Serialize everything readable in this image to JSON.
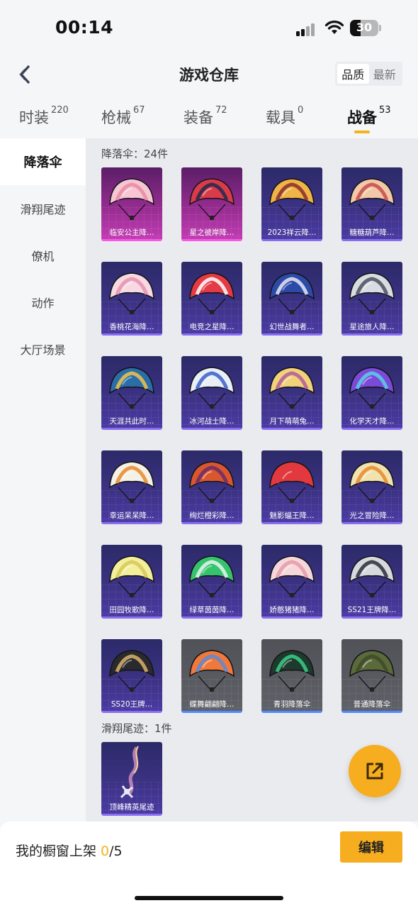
{
  "status_bar": {
    "time": "00:14",
    "battery": "30"
  },
  "header": {
    "title": "游戏仓库",
    "sort_options": [
      "品质",
      "最新"
    ]
  },
  "tabs": [
    {
      "label": "时装",
      "count": "220"
    },
    {
      "label": "枪械",
      "count": "67"
    },
    {
      "label": "装备",
      "count": "72"
    },
    {
      "label": "载具",
      "count": "0"
    },
    {
      "label": "战备",
      "count": "53"
    }
  ],
  "sidebar": {
    "items": [
      "降落伞",
      "滑翔尾迹",
      "僚机",
      "动作",
      "大厅场景"
    ]
  },
  "sections": {
    "parachutes": {
      "title": "降落伞：24件",
      "items": [
        {
          "name": "临安公主降…",
          "rarity": "pink",
          "icon": "pink-floral-canopy"
        },
        {
          "name": "星之彼岸降…",
          "rarity": "pink",
          "icon": "dark-star-canopy"
        },
        {
          "name": "2023祥云降…",
          "rarity": "purple",
          "icon": "golden-cloud-canopy"
        },
        {
          "name": "糖糖葫芦降…",
          "rarity": "purple",
          "icon": "candy-canopy"
        },
        {
          "name": "香桃花海降…",
          "rarity": "purple",
          "icon": "peach-blossom-canopy"
        },
        {
          "name": "电竞之星降…",
          "rarity": "purple",
          "icon": "red-esports-canopy"
        },
        {
          "name": "幻世战舞者…",
          "rarity": "purple",
          "icon": "blue-dancer-canopy"
        },
        {
          "name": "星途旅人降…",
          "rarity": "purple",
          "icon": "round-traveler-canopy"
        },
        {
          "name": "天涯共此时…",
          "rarity": "purple",
          "icon": "teal-moon-canopy"
        },
        {
          "name": "冰河战士降…",
          "rarity": "purple",
          "icon": "white-blue-canopy"
        },
        {
          "name": "月下萌萌兔…",
          "rarity": "purple",
          "icon": "bunny-canopy"
        },
        {
          "name": "化学天才降…",
          "rarity": "purple",
          "icon": "purple-chem-canopy"
        },
        {
          "name": "幸运呆呆降…",
          "rarity": "purple",
          "icon": "lucky-canopy"
        },
        {
          "name": "绚烂橙彩降…",
          "rarity": "purple",
          "icon": "orange-stripe-canopy"
        },
        {
          "name": "魅影蝠王降…",
          "rarity": "purple",
          "icon": "red-round-canopy"
        },
        {
          "name": "光之冒险降…",
          "rarity": "purple",
          "icon": "light-adventure-canopy"
        },
        {
          "name": "田园牧歌降…",
          "rarity": "purple",
          "icon": "yellow-square-canopy"
        },
        {
          "name": "绿草茵茵降…",
          "rarity": "purple",
          "icon": "green-canopy"
        },
        {
          "name": "娇憨猪猪降…",
          "rarity": "purple",
          "icon": "piggy-canopy"
        },
        {
          "name": "SS21王牌降…",
          "rarity": "purple",
          "icon": "ss21-canopy"
        },
        {
          "name": "SS20王牌…",
          "rarity": "purple",
          "icon": "ss20-canopy"
        },
        {
          "name": "蝶舞翩翩降…",
          "rarity": "gray",
          "icon": "butterfly-canopy"
        },
        {
          "name": "青羽降落伞",
          "rarity": "gray",
          "icon": "feather-canopy"
        },
        {
          "name": "普通降落伞",
          "rarity": "gray",
          "icon": "basic-canopy"
        }
      ]
    },
    "trails": {
      "title": "滑翔尾迹：1件",
      "items": [
        {
          "name": "顶峰精英尾迹",
          "rarity": "purple",
          "icon": "skydiver-trail"
        }
      ]
    }
  },
  "bottom": {
    "label": "我的橱窗上架 ",
    "current": "0",
    "total": "/5",
    "edit": "编辑"
  },
  "colors": {
    "accent": "#f6ad1f",
    "purple_card": "#3b3283",
    "pink_card": "#9a2d93",
    "gray_card": "#5f6168"
  }
}
